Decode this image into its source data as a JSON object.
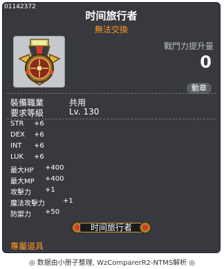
{
  "item": {
    "id": "01142372",
    "name": "时间旅行者",
    "trade_status": "無法交換",
    "combat_power_label": "戰鬥力提升量",
    "combat_power_value": "0",
    "compare_button": "動章",
    "icon": "medal-icon"
  },
  "requirements": [
    {
      "label": "裝備職業",
      "value": "共用"
    },
    {
      "label": "要求等級",
      "value": "Lv. 130"
    }
  ],
  "stats": [
    {
      "label": "STR",
      "value": "+6"
    },
    {
      "label": "DEX",
      "value": "+6"
    },
    {
      "label": "INT",
      "value": "+6"
    },
    {
      "label": "LUK",
      "value": "+6"
    },
    {
      "label": "最大HP",
      "value": "+400"
    },
    {
      "label": "最大MP",
      "value": "+400"
    },
    {
      "label": "攻擊力",
      "value": "+1"
    },
    {
      "label": "魔法攻擊力",
      "value": "+1"
    },
    {
      "label": "防禦力",
      "value": "+50"
    }
  ],
  "set_name": "时间旅行者",
  "exclusive_label": "專屬道具",
  "footer": "◎ 数据由小册子整理, WzComparerR2-NTMS解析 ◎",
  "colors": {
    "accent_orange": "#ff9a22",
    "panel_bg": "#37393f"
  }
}
